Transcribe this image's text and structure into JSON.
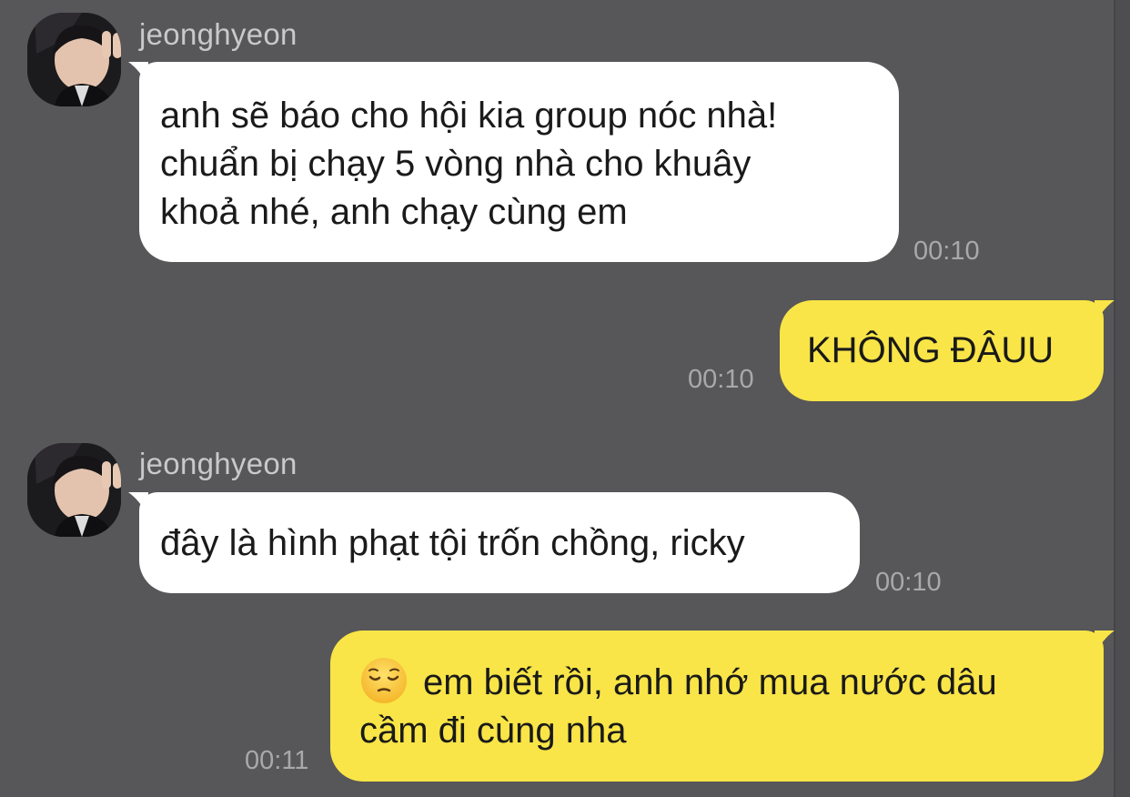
{
  "conversation": {
    "messages": [
      {
        "sender": "jeonghyeon",
        "side": "left",
        "lines": [
          "anh sẽ báo cho hội kia group nóc nhà!",
          "chuẩn bị chạy 5 vòng nhà cho khuây",
          "khoả nhé, anh chạy cùng em"
        ],
        "time": "00:10"
      },
      {
        "side": "right",
        "lines": [
          "KHÔNG ĐÂUU"
        ],
        "time": "00:10"
      },
      {
        "sender": "jeonghyeon",
        "side": "left",
        "lines": [
          "đây là hình phạt tội trốn chồng, ricky"
        ],
        "time": "00:10"
      },
      {
        "side": "right",
        "emoji": "pensive-face",
        "lines": [
          "em biết rồi, anh nhớ mua nước dâu",
          "cầm đi cùng nha"
        ],
        "time": "00:11"
      }
    ]
  },
  "colors": {
    "background": "#575658",
    "incoming_bubble": "#ffffff",
    "outgoing_bubble": "#f9e547",
    "timestamp": "#a9a8aa",
    "sender_name": "#c9c8ca"
  }
}
